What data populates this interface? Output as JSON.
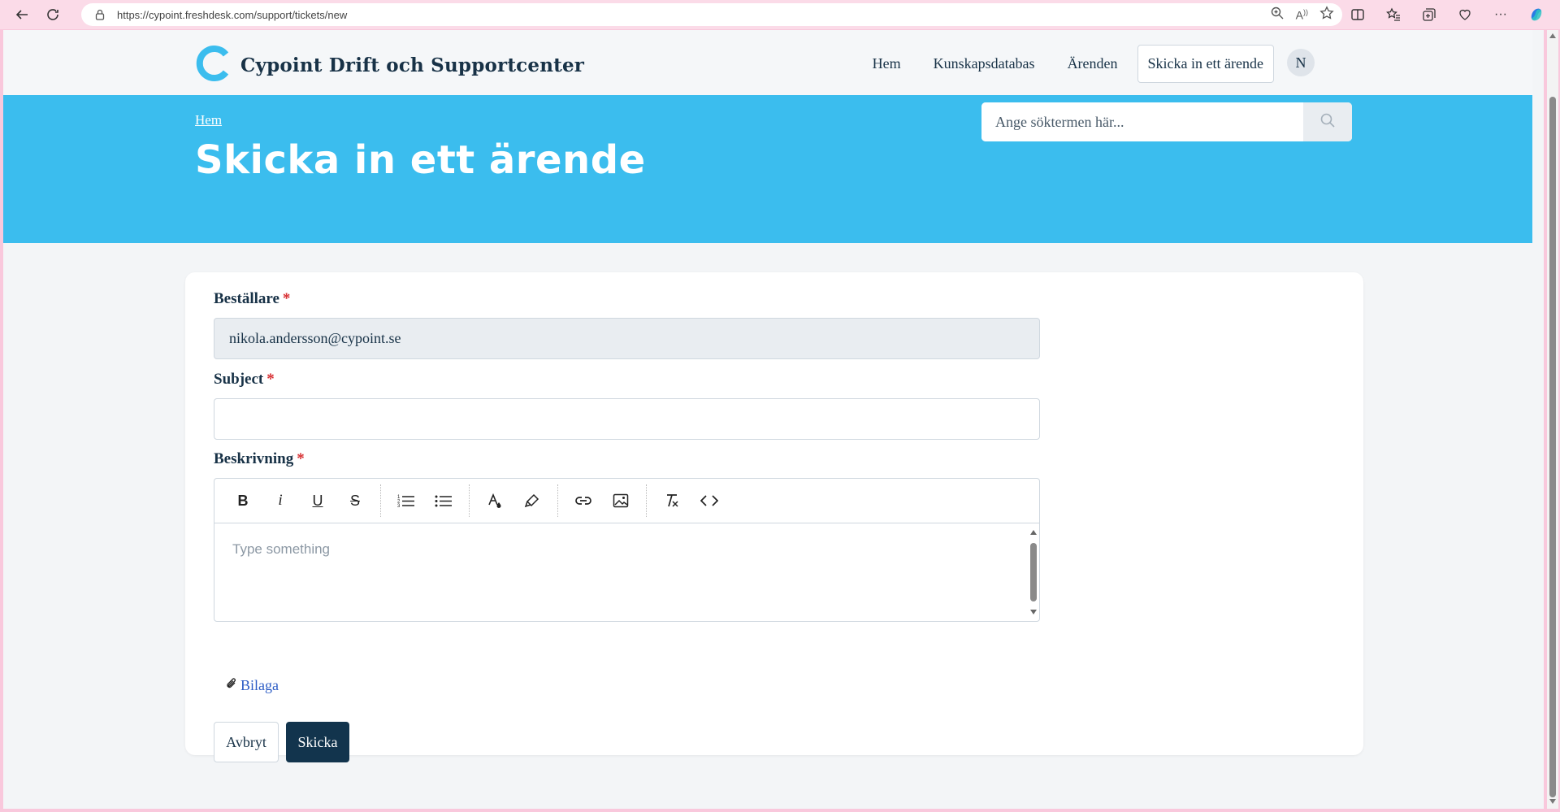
{
  "browser": {
    "url": "https://cypoint.freshdesk.com/support/tickets/new"
  },
  "header": {
    "brand": "Cypoint Drift och Supportcenter",
    "nav": {
      "home": "Hem",
      "kb": "Kunskapsdatabas",
      "tickets": "Ärenden",
      "submit": "Skicka in ett ärende"
    },
    "avatar_initial": "N"
  },
  "hero": {
    "breadcrumb": "Hem",
    "title": "Skicka in ett ärende",
    "search_placeholder": "Ange söktermen här..."
  },
  "form": {
    "requester_label": "Beställare",
    "requester_value": "nikola.andersson@cypoint.se",
    "subject_label": "Subject",
    "subject_value": "",
    "description_label": "Beskrivning",
    "description_placeholder": "Type something",
    "required_mark": "*",
    "attachment_label": "Bilaga",
    "cancel_label": "Avbryt",
    "submit_label": "Skicka"
  },
  "colors": {
    "hero_bg": "#3bbdee",
    "brand_text": "#183247",
    "primary_button": "#12344d",
    "link": "#2c5cc5",
    "required": "#d72d30"
  }
}
